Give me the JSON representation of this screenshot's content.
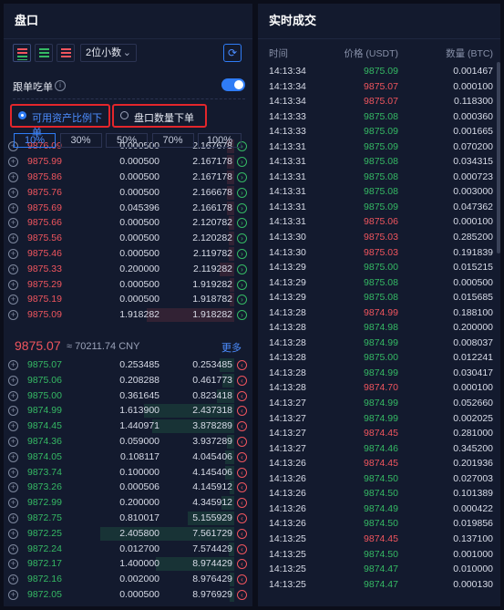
{
  "orderbook": {
    "title": "盘口",
    "precision": "2位小数",
    "follow_label": "跟单吃单",
    "radio_asset_ratio": "可用资产比例下单",
    "radio_qty": "盘口数量下单",
    "percents": [
      "10%",
      "30%",
      "50%",
      "70%",
      "100%"
    ],
    "active_percent": "10%",
    "asks": [
      {
        "price": "9876.09",
        "qty": "0.000500",
        "cum": "2.167678",
        "depth": 0.05
      },
      {
        "price": "9875.99",
        "qty": "0.000500",
        "cum": "2.167178",
        "depth": 0.05
      },
      {
        "price": "9875.86",
        "qty": "0.000500",
        "cum": "2.167178",
        "depth": 0.05
      },
      {
        "price": "9875.76",
        "qty": "0.000500",
        "cum": "2.166678",
        "depth": 0.05
      },
      {
        "price": "9875.69",
        "qty": "0.045396",
        "cum": "2.166178",
        "depth": 0.05
      },
      {
        "price": "9875.66",
        "qty": "0.000500",
        "cum": "2.120782",
        "depth": 0.04
      },
      {
        "price": "9875.56",
        "qty": "0.000500",
        "cum": "2.120282",
        "depth": 0.04
      },
      {
        "price": "9875.46",
        "qty": "0.000500",
        "cum": "2.119782",
        "depth": 0.04
      },
      {
        "price": "9875.33",
        "qty": "0.200000",
        "cum": "2.119282",
        "depth": 0.1
      },
      {
        "price": "9875.29",
        "qty": "0.000500",
        "cum": "1.919282",
        "depth": 0.03
      },
      {
        "price": "9875.19",
        "qty": "0.000500",
        "cum": "1.918782",
        "depth": 0.03
      },
      {
        "price": "9875.09",
        "qty": "1.918282",
        "cum": "1.918282",
        "depth": 0.6
      }
    ],
    "last_price": "9875.07",
    "last_cny": "≈ 70211.74 CNY",
    "more": "更多",
    "bids": [
      {
        "price": "9875.07",
        "qty": "0.253485",
        "cum": "0.253485",
        "depth": 0.1
      },
      {
        "price": "9875.06",
        "qty": "0.208288",
        "cum": "0.461773",
        "depth": 0.08
      },
      {
        "price": "9875.00",
        "qty": "0.361645",
        "cum": "0.823418",
        "depth": 0.12
      },
      {
        "price": "9874.99",
        "qty": "1.613900",
        "cum": "2.437318",
        "depth": 0.62
      },
      {
        "price": "9874.45",
        "qty": "1.440971",
        "cum": "3.878289",
        "depth": 0.56
      },
      {
        "price": "9874.36",
        "qty": "0.059000",
        "cum": "3.937289",
        "depth": 0.05
      },
      {
        "price": "9874.05",
        "qty": "0.108117",
        "cum": "4.045406",
        "depth": 0.06
      },
      {
        "price": "9873.74",
        "qty": "0.100000",
        "cum": "4.145406",
        "depth": 0.06
      },
      {
        "price": "9873.26",
        "qty": "0.000506",
        "cum": "4.145912",
        "depth": 0.03
      },
      {
        "price": "9872.99",
        "qty": "0.200000",
        "cum": "4.345912",
        "depth": 0.09
      },
      {
        "price": "9872.75",
        "qty": "0.810017",
        "cum": "5.155929",
        "depth": 0.32
      },
      {
        "price": "9872.25",
        "qty": "2.405800",
        "cum": "7.561729",
        "depth": 0.92
      },
      {
        "price": "9872.24",
        "qty": "0.012700",
        "cum": "7.574429",
        "depth": 0.04
      },
      {
        "price": "9872.17",
        "qty": "1.400000",
        "cum": "8.974429",
        "depth": 0.54
      },
      {
        "price": "9872.16",
        "qty": "0.002000",
        "cum": "8.976429",
        "depth": 0.03
      },
      {
        "price": "9872.05",
        "qty": "0.000500",
        "cum": "8.976929",
        "depth": 0.03
      }
    ]
  },
  "trades": {
    "title": "实时成交",
    "col_time": "时间",
    "col_price": "价格 (USDT)",
    "col_qty": "数量 (BTC)",
    "rows": [
      {
        "time": "14:13:34",
        "price": "9875.09",
        "qty": "0.001467",
        "side": "buy"
      },
      {
        "time": "14:13:34",
        "price": "9875.07",
        "qty": "0.000100",
        "side": "sell"
      },
      {
        "time": "14:13:34",
        "price": "9875.07",
        "qty": "0.118300",
        "side": "sell"
      },
      {
        "time": "14:13:33",
        "price": "9875.08",
        "qty": "0.000360",
        "side": "buy"
      },
      {
        "time": "14:13:33",
        "price": "9875.09",
        "qty": "0.001665",
        "side": "buy"
      },
      {
        "time": "14:13:31",
        "price": "9875.09",
        "qty": "0.070200",
        "side": "buy"
      },
      {
        "time": "14:13:31",
        "price": "9875.08",
        "qty": "0.034315",
        "side": "buy"
      },
      {
        "time": "14:13:31",
        "price": "9875.08",
        "qty": "0.000723",
        "side": "buy"
      },
      {
        "time": "14:13:31",
        "price": "9875.08",
        "qty": "0.003000",
        "side": "buy"
      },
      {
        "time": "14:13:31",
        "price": "9875.09",
        "qty": "0.047362",
        "side": "buy"
      },
      {
        "time": "14:13:31",
        "price": "9875.06",
        "qty": "0.000100",
        "side": "sell"
      },
      {
        "time": "14:13:30",
        "price": "9875.03",
        "qty": "0.285200",
        "side": "sell"
      },
      {
        "time": "14:13:30",
        "price": "9875.03",
        "qty": "0.191839",
        "side": "sell"
      },
      {
        "time": "14:13:29",
        "price": "9875.00",
        "qty": "0.015215",
        "side": "buy"
      },
      {
        "time": "14:13:29",
        "price": "9875.08",
        "qty": "0.000500",
        "side": "buy"
      },
      {
        "time": "14:13:29",
        "price": "9875.08",
        "qty": "0.015685",
        "side": "buy"
      },
      {
        "time": "14:13:28",
        "price": "9874.99",
        "qty": "0.188100",
        "side": "sell"
      },
      {
        "time": "14:13:28",
        "price": "9874.98",
        "qty": "0.200000",
        "side": "buy"
      },
      {
        "time": "14:13:28",
        "price": "9874.99",
        "qty": "0.008037",
        "side": "buy"
      },
      {
        "time": "14:13:28",
        "price": "9875.00",
        "qty": "0.012241",
        "side": "buy"
      },
      {
        "time": "14:13:28",
        "price": "9874.99",
        "qty": "0.030417",
        "side": "buy"
      },
      {
        "time": "14:13:28",
        "price": "9874.70",
        "qty": "0.000100",
        "side": "sell"
      },
      {
        "time": "14:13:27",
        "price": "9874.99",
        "qty": "0.052660",
        "side": "buy"
      },
      {
        "time": "14:13:27",
        "price": "9874.99",
        "qty": "0.002025",
        "side": "buy"
      },
      {
        "time": "14:13:27",
        "price": "9874.45",
        "qty": "0.281000",
        "side": "sell"
      },
      {
        "time": "14:13:27",
        "price": "9874.46",
        "qty": "0.345200",
        "side": "buy"
      },
      {
        "time": "14:13:26",
        "price": "9874.45",
        "qty": "0.201936",
        "side": "sell"
      },
      {
        "time": "14:13:26",
        "price": "9874.50",
        "qty": "0.027003",
        "side": "buy"
      },
      {
        "time": "14:13:26",
        "price": "9874.50",
        "qty": "0.101389",
        "side": "buy"
      },
      {
        "time": "14:13:26",
        "price": "9874.49",
        "qty": "0.000422",
        "side": "buy"
      },
      {
        "time": "14:13:26",
        "price": "9874.50",
        "qty": "0.019856",
        "side": "buy"
      },
      {
        "time": "14:13:25",
        "price": "9874.45",
        "qty": "0.137100",
        "side": "sell"
      },
      {
        "time": "14:13:25",
        "price": "9874.50",
        "qty": "0.001000",
        "side": "buy"
      },
      {
        "time": "14:13:25",
        "price": "9874.47",
        "qty": "0.010000",
        "side": "buy"
      },
      {
        "time": "14:13:25",
        "price": "9874.47",
        "qty": "0.000130",
        "side": "buy"
      }
    ]
  },
  "colors": {
    "buy": "#35b964",
    "sell": "#f0555e",
    "accent": "#2f7cf6",
    "highlight": "#e3262b"
  }
}
